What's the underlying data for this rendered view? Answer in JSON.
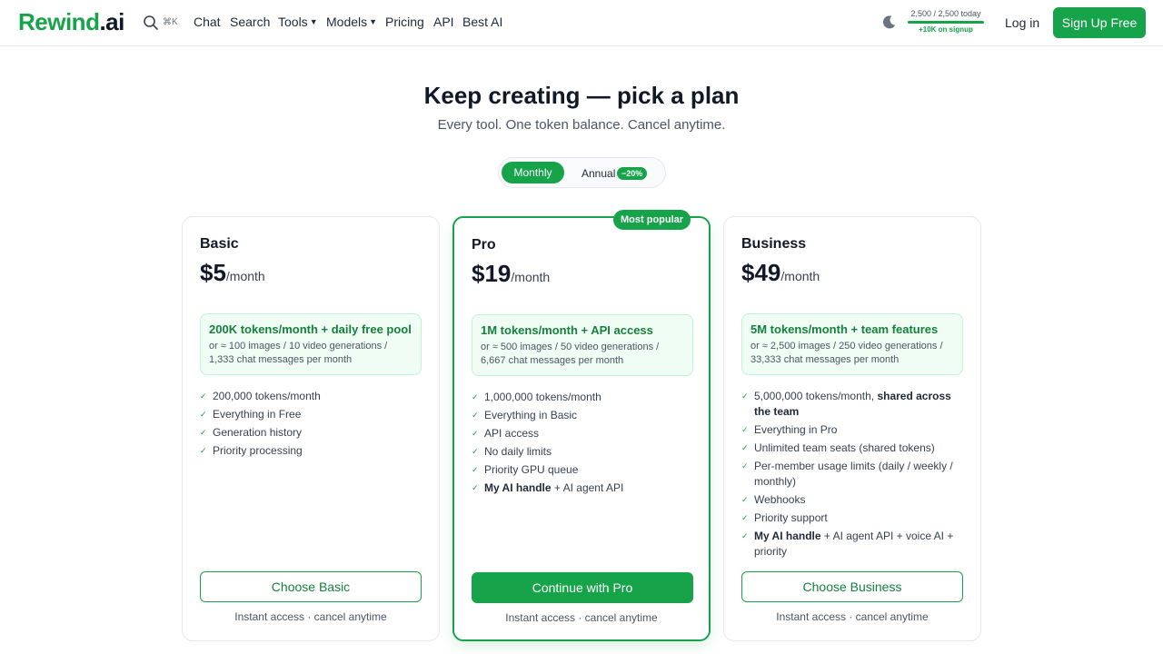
{
  "header": {
    "logo_main": "Rewind",
    "logo_suffix": ".ai",
    "search_shortcut": "⌘K",
    "nav": {
      "chat": "Chat",
      "search": "Search",
      "tools": "Tools",
      "models": "Models",
      "pricing": "Pricing",
      "api": "API",
      "best_ai": "Best AI"
    },
    "quota_text": "2,500 / 2,500 today",
    "quota_bonus": "+10K on signup",
    "login": "Log in",
    "signup": "Sign Up Free"
  },
  "hero": {
    "title": "Keep creating — pick a plan",
    "subtitle": "Every tool. One token balance. Cancel anytime."
  },
  "billing_toggle": {
    "monthly": "Monthly",
    "annual": "Annual",
    "annual_badge": "−20%"
  },
  "plans": [
    {
      "name": "Basic",
      "price": "$5",
      "period": "/month",
      "token_title": "200K tokens/month + daily free pool",
      "token_sub": "or ≈ 100 images / 10 video generations / 1,333 chat messages per month",
      "features": [
        "200,000 tokens/month",
        "Everything in Free",
        "Generation history",
        "Priority processing"
      ],
      "cta": "Choose Basic",
      "note": "Instant access · cancel anytime"
    },
    {
      "name": "Pro",
      "badge": "Most popular",
      "price": "$19",
      "period": "/month",
      "token_title": "1M tokens/month + API access",
      "token_sub": "or ≈ 500 images / 50 video generations / 6,667 chat messages per month",
      "features": [
        "1,000,000 tokens/month",
        "Everything in Basic",
        "API access",
        "No daily limits",
        "Priority GPU queue"
      ],
      "feature_handle_bold": "My AI handle",
      "feature_handle_rest": " + AI agent API",
      "cta": "Continue with Pro",
      "note": "Instant access · cancel anytime"
    },
    {
      "name": "Business",
      "price": "$49",
      "period": "/month",
      "token_title": "5M tokens/month + team features",
      "token_sub": "or ≈ 2,500 images / 250 video generations / 33,333 chat messages per month",
      "feature_tokens_plain": "5,000,000 tokens/month, ",
      "feature_tokens_bold": "shared across the team",
      "features": [
        "Everything in Pro",
        "Unlimited team seats (shared tokens)",
        "Per-member usage limits (daily / weekly / monthly)",
        "Webhooks",
        "Priority support"
      ],
      "feature_handle_bold": "My AI handle",
      "feature_handle_rest": " + AI agent API + voice AI + priority",
      "cta": "Choose Business",
      "note": "Instant access · cancel anytime"
    }
  ],
  "colors": {
    "accent": "#16a34a",
    "accent_dark": "#15803d",
    "token_box_bg": "#f0fdf4"
  }
}
